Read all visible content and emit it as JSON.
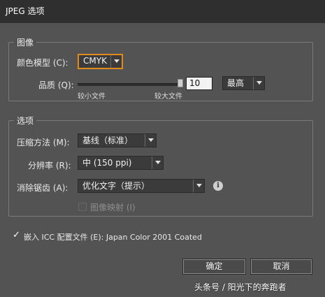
{
  "window": {
    "title": "JPEG 选项"
  },
  "image_group": {
    "legend": "图像",
    "color_model_label": "颜色模型 (C):",
    "color_model_value": "CMYK",
    "quality_label": "品质 (Q):",
    "quality_value": "10",
    "quality_preset": "最高",
    "slider_min_label": "较小文件",
    "slider_max_label": "较大文件"
  },
  "options_group": {
    "legend": "选项",
    "compression_label": "压缩方法 (M):",
    "compression_value": "基线（标准）",
    "resolution_label": "分辨率 (R):",
    "resolution_value": "中 (150 ppi)",
    "antialias_label": "消除锯齿 (A):",
    "antialias_value": "优化文字（提示）",
    "imagemap_label": "图像映射 (I)",
    "imagemap_checked": false
  },
  "icc": {
    "label": "嵌入 ICC 配置文件 (E): Japan Color 2001 Coated",
    "checked": true
  },
  "buttons": {
    "ok": "确定",
    "cancel": "取消"
  },
  "watermark": "头条号 / 阳光下的奔跑者"
}
